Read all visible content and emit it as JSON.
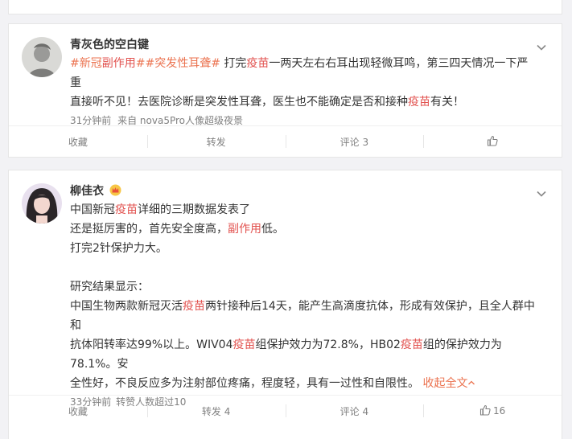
{
  "posts": [
    {
      "author": "青灰色的空白键",
      "text": {
        "topic1": "#新冠",
        "topic1_hl": "副作用",
        "topic1_end": "#",
        "topic2": "#突发性耳聋#",
        "p1": " 打完",
        "hl1": "疫苗",
        "p2": "一两天左右右耳出现轻微耳鸣，第三四天情况一下严重",
        "p3": "直接听不见！去医院诊断是突发性耳聋，医生也不能确定是否和接种",
        "hl2": "疫苗",
        "p4": "有关！"
      },
      "time": "31分钟前",
      "source": "来自 nova5Pro人像超级夜景",
      "actions": {
        "favorite": "收藏",
        "repost": "转发",
        "comment": "评论 3",
        "like": ""
      }
    },
    {
      "author": "柳佳衣",
      "lines": {
        "l1a": "中国新冠",
        "l1hl": "疫苗",
        "l1b": "详细的三期数据发表了",
        "l2a": "还是挺厉害的，首先安全度高，",
        "l2hl": "副作用",
        "l2b": "低。",
        "l3": "打完2针保护力大。",
        "l4": "研究结果显示：",
        "l5a": "中国生物两款新冠灭活",
        "l5hl": "疫苗",
        "l5b": "两针接种后14天，能产生高滴度抗体，形成有效保护，且全人群中和",
        "l6a": "抗体阳转率达99%以上。WIV04",
        "l6hl1": "疫苗",
        "l6b": "组保护效力为72.8%，HB02",
        "l6hl2": "疫苗",
        "l6c": "组的保护效力为78.1%。安",
        "l7": "全性好，不良反应多为注射部位疼痛，程度轻，具有一过性和自限性。",
        "collapse": "收起全文"
      },
      "time": "33分钟前",
      "extra": "转赞人数超过10",
      "actions": {
        "favorite": "收藏",
        "repost": "转发 4",
        "comment": "评论 4",
        "like": "16"
      }
    }
  ],
  "colors": {
    "highlight": "#e2524f",
    "topic": "#eb7350",
    "meta": "#808080"
  }
}
